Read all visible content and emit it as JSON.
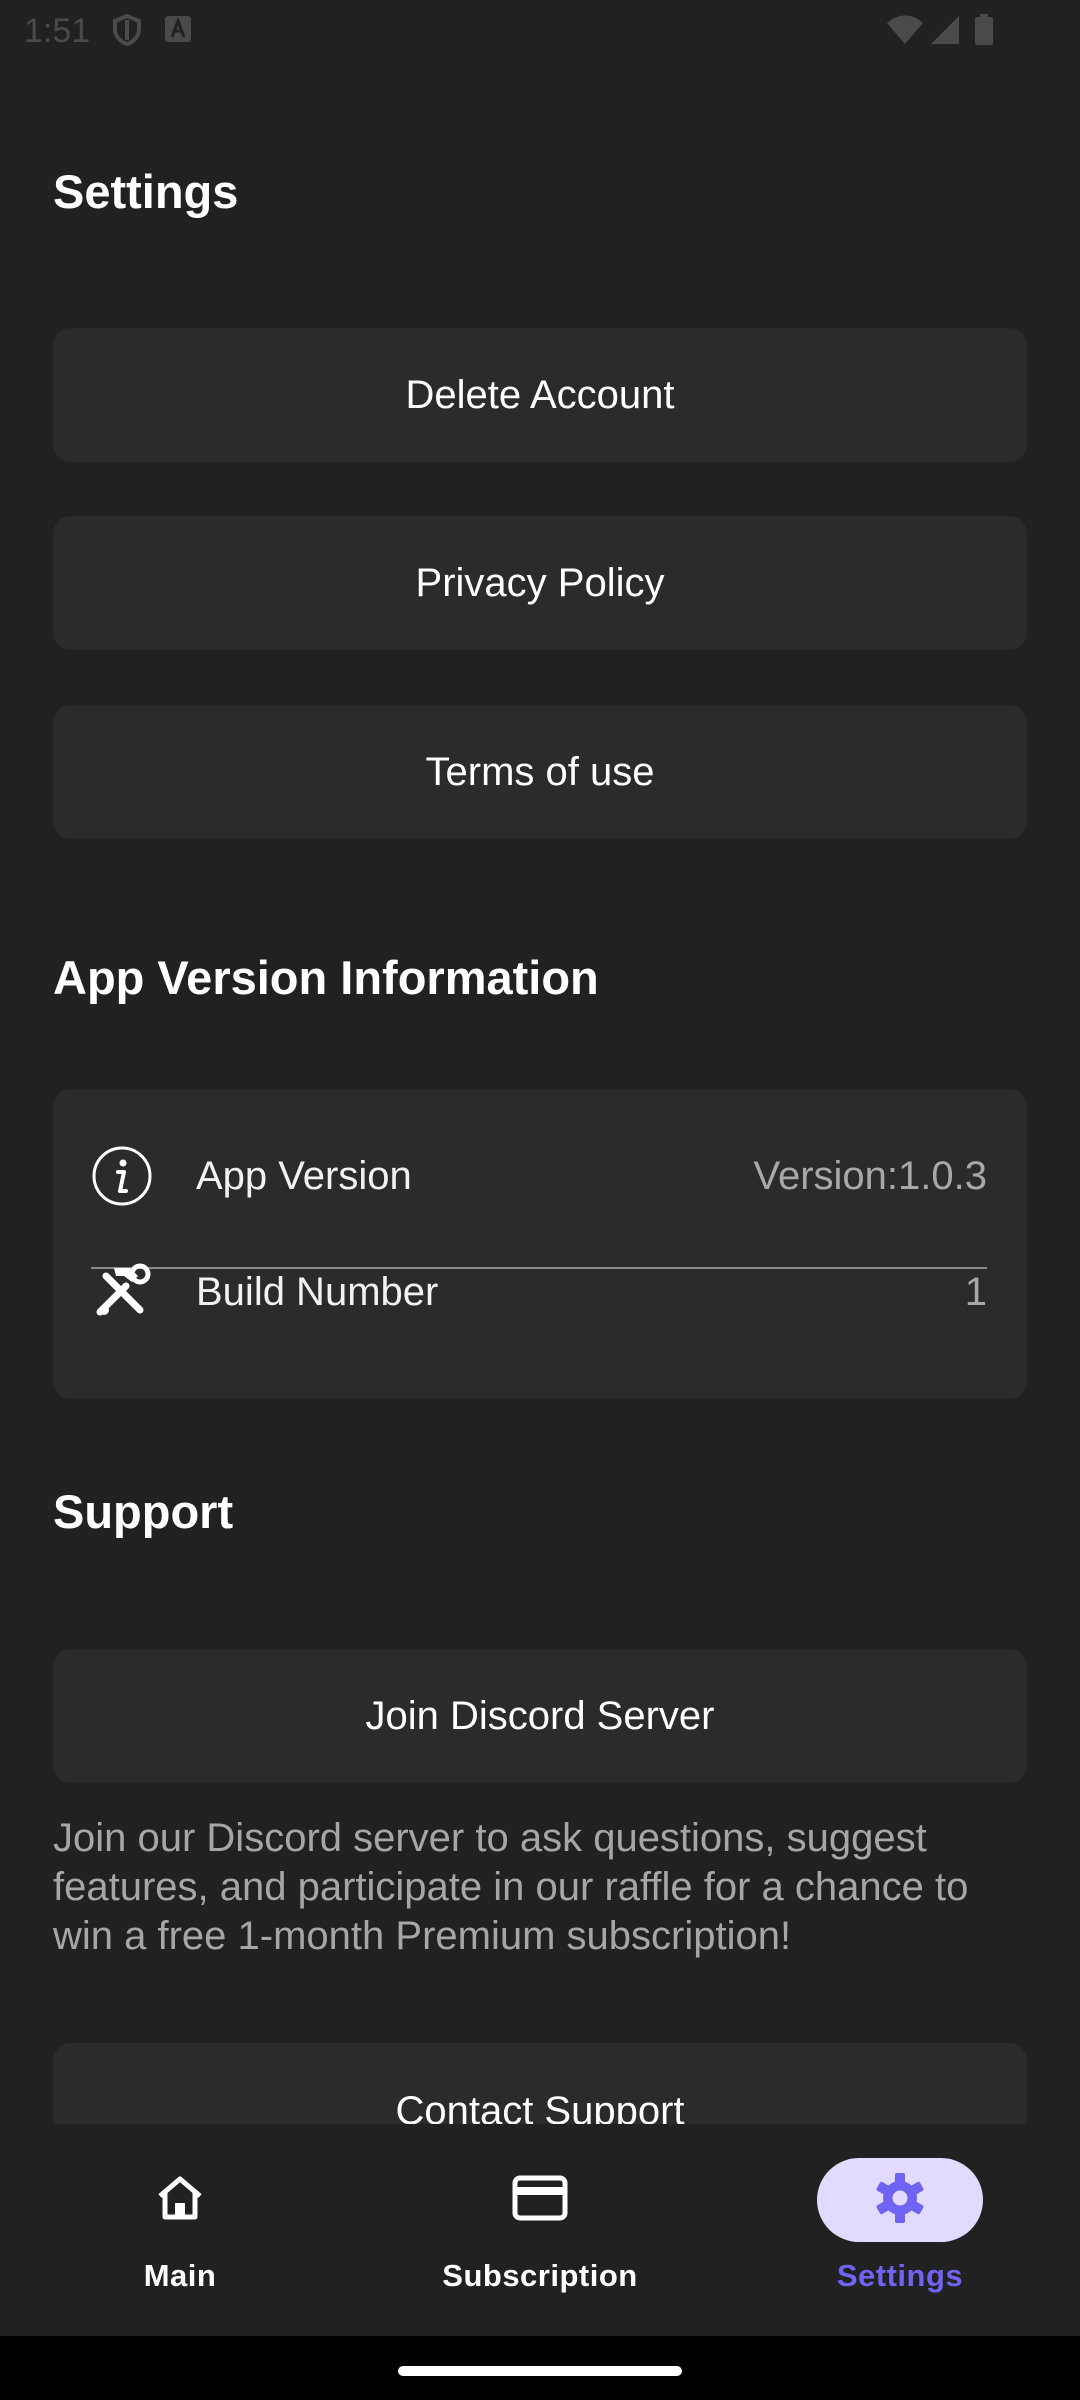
{
  "status_bar": {
    "time": "1:51",
    "left_icons": [
      "shield-icon",
      "app-notification-icon"
    ],
    "right_icons": [
      "wifi-icon",
      "signal-icon",
      "battery-icon"
    ]
  },
  "settings": {
    "title": "Settings",
    "buttons": [
      {
        "label": "Delete Account"
      },
      {
        "label": "Privacy Policy"
      },
      {
        "label": "Terms of use"
      }
    ]
  },
  "app_version_info": {
    "title": "App Version Information",
    "rows": [
      {
        "icon": "info-icon",
        "label": "App Version",
        "value": "Version:1.0.3"
      },
      {
        "icon": "tools-icon",
        "label": "Build Number",
        "value": "1"
      }
    ]
  },
  "support": {
    "title": "Support",
    "discord_button": "Join Discord Server",
    "description": "Join our Discord server to ask questions, suggest features, and participate in our raffle for a chance to win a free 1-month Premium subscription!",
    "contact_button": "Contact Support"
  },
  "bottom_nav": {
    "items": [
      {
        "label": "Main",
        "icon": "home-icon",
        "active": false
      },
      {
        "label": "Subscription",
        "icon": "card-icon",
        "active": false
      },
      {
        "label": "Settings",
        "icon": "gear-icon",
        "active": true
      }
    ]
  },
  "colors": {
    "background": "#212121",
    "card": "#2b2b2c",
    "accent": "#6f63f2",
    "accent_pill": "#e3dbff"
  }
}
